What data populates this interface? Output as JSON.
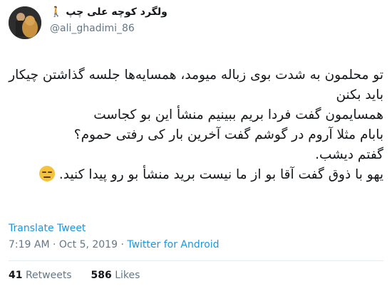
{
  "author": {
    "display_name": "ولگرد کوچه علی چپ",
    "name_emoji": "🚶",
    "handle": "@ali_ghadimi_86"
  },
  "tweet": {
    "lines": [
      "تو محلمون به شدت بوی زباله میومد، همسایه‌ها جلسه گذاشتن چیکار باید بکنن",
      "همسایمون گفت فردا بریم ببینیم منشأ این بو کجاست",
      "بابام مثلا آروم در گوشم گفت آخرین بار کی رفتی حموم؟",
      "گفتم دیشب.",
      "یهو با ذوق گفت آقا بو از ما نیست برید منشأ بو رو پیدا کنید."
    ],
    "emoji": "expressionless-face"
  },
  "translate_label": "Translate Tweet",
  "meta": {
    "time": "7:19 AM",
    "separator": "·",
    "date": "Oct 5, 2019",
    "source": "Twitter for Android"
  },
  "stats": {
    "retweets_count": "41",
    "retweets_label": "Retweets",
    "likes_count": "586",
    "likes_label": "Likes"
  }
}
